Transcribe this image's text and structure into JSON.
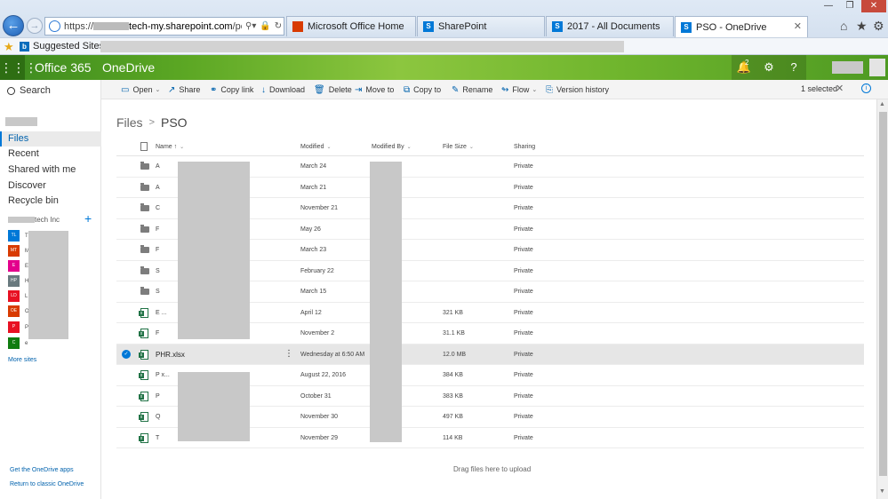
{
  "browser": {
    "url_prefix": "https://",
    "url_domain": "tech-my.sharepoint.com",
    "url_suffix": "/persona",
    "tabs": [
      {
        "label": "Microsoft Office Home",
        "color": "#d83b01"
      },
      {
        "label": "SharePoint",
        "color": "#0078d7"
      },
      {
        "label": "2017 - All Documents",
        "color": "#0078d7"
      },
      {
        "label": "PSO - OneDrive",
        "color": "#0078d7"
      }
    ],
    "favorites_label": "Suggested Sites"
  },
  "suitebar": {
    "brand": "Office 365",
    "app": "OneDrive",
    "notification_count": "2"
  },
  "leftnav": {
    "search_label": "Search",
    "items": [
      "Files",
      "Recent",
      "Shared with me",
      "Discover",
      "Recycle bin"
    ],
    "org_suffix": "tech Inc",
    "sites": [
      {
        "abbr": "TL",
        "color": "#0078d7",
        "text": "T"
      },
      {
        "abbr": "MT",
        "color": "#d83b01",
        "text": "M"
      },
      {
        "abbr": "E",
        "color": "#e3008c",
        "text": "E"
      },
      {
        "abbr": "HP",
        "color": "#69797e",
        "text": "H"
      },
      {
        "abbr": "LD",
        "color": "#e81123",
        "text": "L"
      },
      {
        "abbr": "OE",
        "color": "#d83b01",
        "text": "O                ng"
      },
      {
        "abbr": "P",
        "color": "#e81123",
        "text": "P"
      },
      {
        "abbr": "C",
        "color": "#107c10",
        "text": "e"
      }
    ],
    "more_sites": "More sites",
    "footer_apps": "Get the OneDrive apps",
    "footer_classic": "Return to classic OneDrive"
  },
  "commands": [
    "Open",
    "Share",
    "Copy link",
    "Download",
    "Delete",
    "Move to",
    "Copy to",
    "Rename",
    "Flow",
    "Version history"
  ],
  "selection": {
    "label": "1 selected"
  },
  "breadcrumb": {
    "root": "Files",
    "current": "PSO"
  },
  "columns": {
    "name": "Name ↑",
    "modified": "Modified",
    "modified_by": "Modified By",
    "file_size": "File Size",
    "sharing": "Sharing"
  },
  "rows": [
    {
      "type": "folder",
      "name": "A",
      "modified": "March 24",
      "size": "",
      "sharing": "Private"
    },
    {
      "type": "folder",
      "name": "A",
      "modified": "March 21",
      "size": "",
      "sharing": "Private"
    },
    {
      "type": "folder",
      "name": "C",
      "modified": "November 21",
      "size": "",
      "sharing": "Private"
    },
    {
      "type": "folder",
      "name": "F",
      "modified": "May 26",
      "size": "",
      "sharing": "Private"
    },
    {
      "type": "folder",
      "name": "F",
      "modified": "March 23",
      "size": "",
      "sharing": "Private"
    },
    {
      "type": "folder",
      "name": "S",
      "modified": "February 22",
      "size": "",
      "sharing": "Private"
    },
    {
      "type": "folder",
      "name": "S",
      "modified": "March 15",
      "size": "",
      "sharing": "Private"
    },
    {
      "type": "xlsx",
      "name": "E                              ...",
      "modified": "April 12",
      "size": "321 KB",
      "sharing": "Private"
    },
    {
      "type": "xlsx",
      "name": "F",
      "modified": "November 2",
      "size": "31.1 KB",
      "sharing": "Private"
    },
    {
      "type": "xlsx",
      "name": "PHR.xlsx",
      "modified": "Wednesday at 6:50 AM",
      "size": "12.0 MB",
      "sharing": "Private",
      "selected": true
    },
    {
      "type": "xlsx",
      "name": "P                              x...",
      "modified": "August 22, 2016",
      "size": "384 KB",
      "sharing": "Private"
    },
    {
      "type": "xlsx",
      "name": "P",
      "modified": "October 31",
      "size": "383 KB",
      "sharing": "Private"
    },
    {
      "type": "xlsx",
      "name": "Q",
      "modified": "November 30",
      "size": "497 KB",
      "sharing": "Private"
    },
    {
      "type": "xlsx",
      "name": "T",
      "modified": "November 29",
      "size": "114 KB",
      "sharing": "Private"
    }
  ],
  "drag_hint": "Drag files here to upload"
}
